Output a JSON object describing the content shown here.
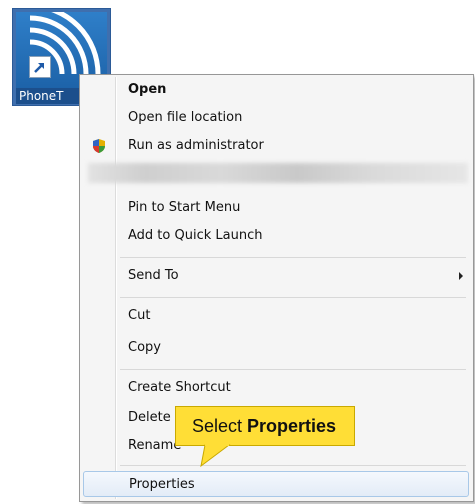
{
  "shortcut": {
    "label": "PhoneT"
  },
  "menu": {
    "items": [
      {
        "label": "Open"
      },
      {
        "label": "Open file location"
      },
      {
        "label": "Run as administrator"
      },
      {
        "label": "Pin to Start Menu"
      },
      {
        "label": "Add to Quick Launch"
      },
      {
        "label": "Send To"
      },
      {
        "label": "Cut"
      },
      {
        "label": "Copy"
      },
      {
        "label": "Create Shortcut"
      },
      {
        "label": "Delete"
      },
      {
        "label": "Rename"
      },
      {
        "label": "Properties"
      }
    ]
  },
  "callout": {
    "prefix": "Select",
    "emphasis": "Properties"
  },
  "colors": {
    "callout_bg": "#ffde36",
    "highlight_border": "#a8c8e8",
    "menu_bg": "#f5f5f5"
  },
  "icons": {
    "shortcut": "phone-tools-shortcut-icon",
    "run_as_admin": "shield-icon",
    "send_to": "submenu-arrow-icon"
  }
}
